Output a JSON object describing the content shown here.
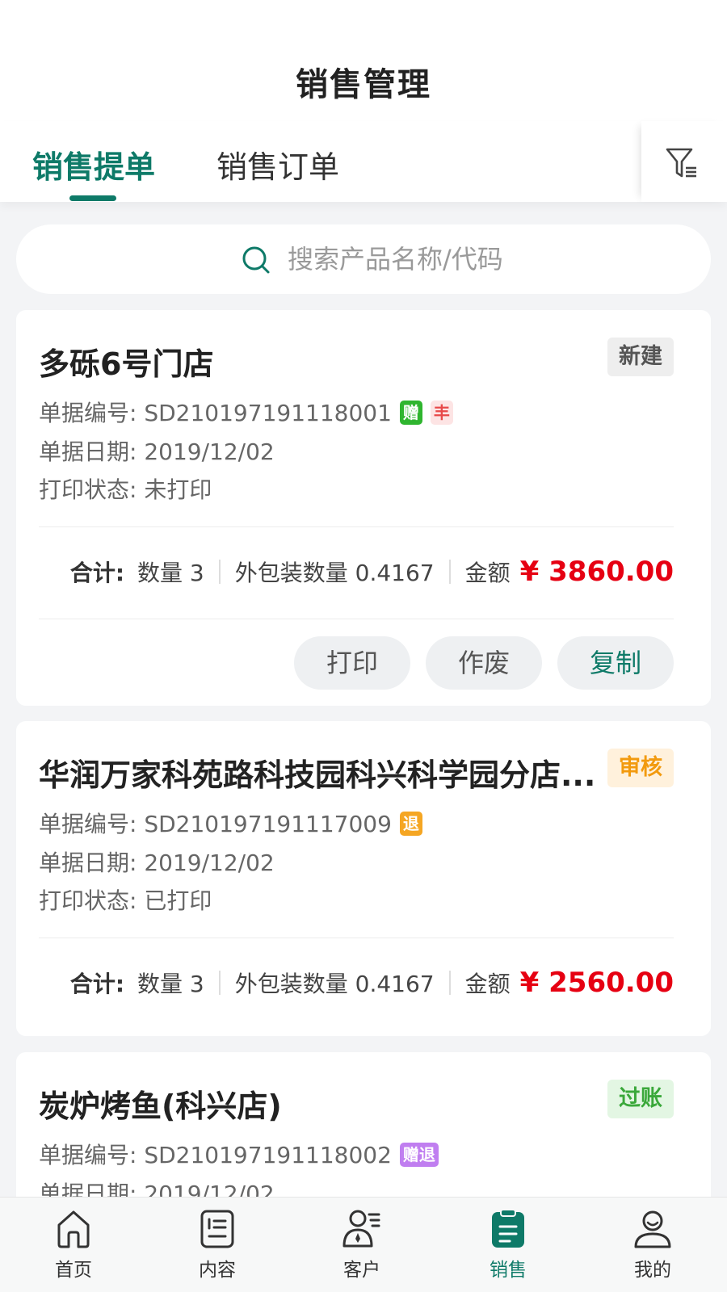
{
  "header": {
    "title": "销售管理"
  },
  "tabs": [
    {
      "label": "销售提单",
      "active": true
    },
    {
      "label": "销售订单",
      "active": false
    }
  ],
  "filter_icon": "filter-icon",
  "search": {
    "placeholder": "搜索产品名称/代码",
    "value": ""
  },
  "colors": {
    "accent": "#0e7a68",
    "price": "#e60012"
  },
  "labels": {
    "doc_no": "单据编号: ",
    "doc_date": "单据日期: ",
    "print_status": "打印状态: ",
    "total": "合计:",
    "qty": "数量 3",
    "pack_qty": "外包装数量 0.4167",
    "amount": "金额",
    "currency": "¥"
  },
  "orders": [
    {
      "store": "多砾6号门店",
      "status": "新建",
      "doc_no": "SD210197191118001",
      "tags": [
        "赠",
        "丰"
      ],
      "date": "2019/12/02",
      "print_status": "未打印",
      "qty": "数量 3",
      "pack_qty": "外包装数量 0.4167",
      "amount": "3860.00",
      "actions": [
        "打印",
        "作废",
        "复制"
      ]
    },
    {
      "store": "华润万家科苑路科技园科兴科学园分店...",
      "status": "审核",
      "doc_no": "SD210197191117009",
      "tags": [
        "退"
      ],
      "date": "2019/12/02",
      "print_status": "已打印",
      "qty": "数量 3",
      "pack_qty": "外包装数量 0.4167",
      "amount": "2560.00"
    },
    {
      "store": "炭炉烤鱼(科兴店)",
      "status": "过账",
      "doc_no": "SD210197191118002",
      "tags": [
        "赠退"
      ],
      "date": "2019/12/02"
    }
  ],
  "bottom_nav": [
    {
      "label": "首页",
      "icon": "home-icon"
    },
    {
      "label": "内容",
      "icon": "content-icon"
    },
    {
      "label": "客户",
      "icon": "customer-icon"
    },
    {
      "label": "销售",
      "icon": "sales-icon",
      "active": true
    },
    {
      "label": "我的",
      "icon": "profile-icon"
    }
  ]
}
